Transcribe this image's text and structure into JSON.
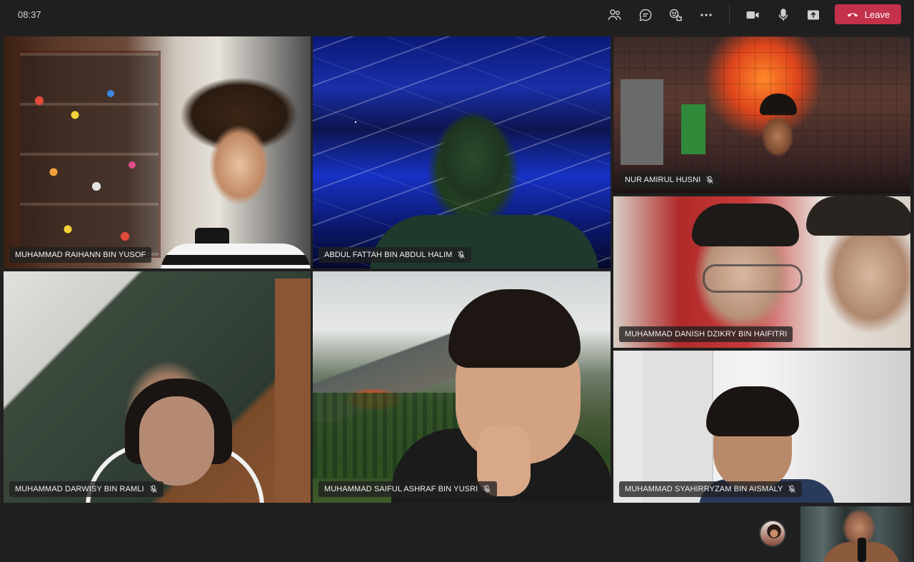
{
  "clock": "08:37",
  "toolbar": {
    "icons": [
      {
        "name": "participants-icon"
      },
      {
        "name": "chat-icon"
      },
      {
        "name": "reactions-icon"
      },
      {
        "name": "more-icon"
      },
      {
        "name": "camera-icon"
      },
      {
        "name": "mic-icon"
      },
      {
        "name": "share-icon"
      }
    ],
    "leave_label": "Leave",
    "leave_color": "#c4314b"
  },
  "participants": [
    {
      "name": "MUHAMMAD RAIHANN BIN YUSOF",
      "muted": false
    },
    {
      "name": "ABDUL FATTAH BIN ABDUL HALIM",
      "muted": true
    },
    {
      "name": "NUR AMIRUL HUSNI",
      "muted": true
    },
    {
      "name": "MUHAMMAD DANISH DZIKRY BIN HAIFITRI",
      "muted": false
    },
    {
      "name": "MUHAMMAD DARWISY BIN RAMLI",
      "muted": true
    },
    {
      "name": "MUHAMMAD SAIFUL ASHRAF BIN YUSRI",
      "muted": true
    },
    {
      "name": "MUHAMMAD SYAHIRRYZAM BIN AISMALY",
      "muted": true
    }
  ]
}
